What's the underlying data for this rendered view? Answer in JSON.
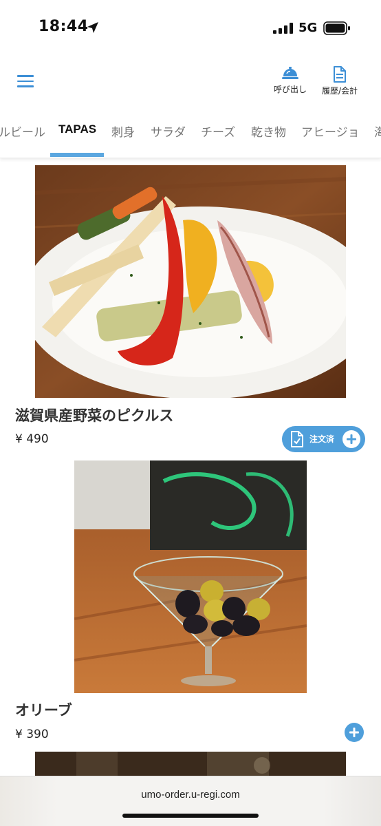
{
  "status": {
    "time": "18:44",
    "network": "5G"
  },
  "header": {
    "call_label": "呼び出し",
    "history_label": "履歴/会計",
    "accent": "#3d8fd6"
  },
  "tabs": [
    {
      "label": "ルビール",
      "active": false
    },
    {
      "label": "TAPAS",
      "active": true
    },
    {
      "label": "刺身",
      "active": false
    },
    {
      "label": "サラダ",
      "active": false
    },
    {
      "label": "チーズ",
      "active": false
    },
    {
      "label": "乾き物",
      "active": false
    },
    {
      "label": "アヒージョ",
      "active": false
    },
    {
      "label": "海",
      "active": false
    }
  ],
  "items": [
    {
      "name": "滋賀県産野菜のピクルス",
      "price": "¥ 490",
      "ordered_label": "注文済",
      "ordered": true,
      "image": "pickled-vegetables-photo"
    },
    {
      "name": "オリーブ",
      "price": "¥ 390",
      "ordered": false,
      "image": "olives-martini-glass-photo"
    }
  ],
  "browser": {
    "url": "umo-order.u-regi.com"
  },
  "colors": {
    "accent": "#4f9fdb",
    "tab_indicator": "#5ba7e0"
  }
}
